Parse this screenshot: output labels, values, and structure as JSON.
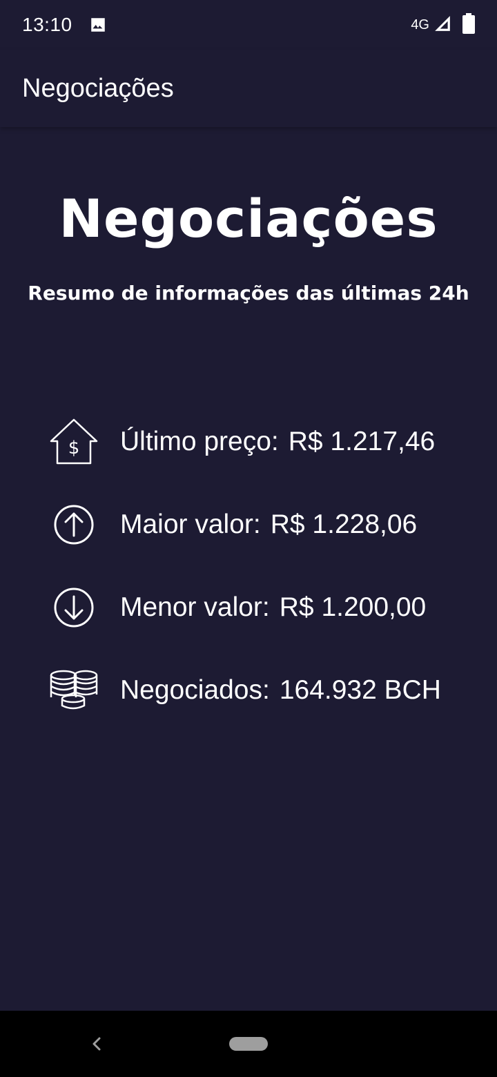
{
  "status_bar": {
    "time": "13:10",
    "network": "4G",
    "icons": [
      "image-icon",
      "signal-icon",
      "battery-icon"
    ]
  },
  "app_bar": {
    "title": "Negociações"
  },
  "hero": {
    "title": "Negociações",
    "subtitle": "Resumo de informações das últimas 24h"
  },
  "stats": [
    {
      "icon": "house-dollar-icon",
      "label": "Último preço:",
      "value": "R$ 1.217,46"
    },
    {
      "icon": "arrow-up-circle-icon",
      "label": "Maior valor:",
      "value": "R$ 1.228,06"
    },
    {
      "icon": "arrow-down-circle-icon",
      "label": "Menor valor:",
      "value": "R$ 1.200,00"
    },
    {
      "icon": "coins-stack-icon",
      "label": "Negociados:",
      "value": "164.932 BCH"
    }
  ],
  "colors": {
    "background": "#1d1b33",
    "text": "#ffffff",
    "nav_bar": "#000000"
  }
}
